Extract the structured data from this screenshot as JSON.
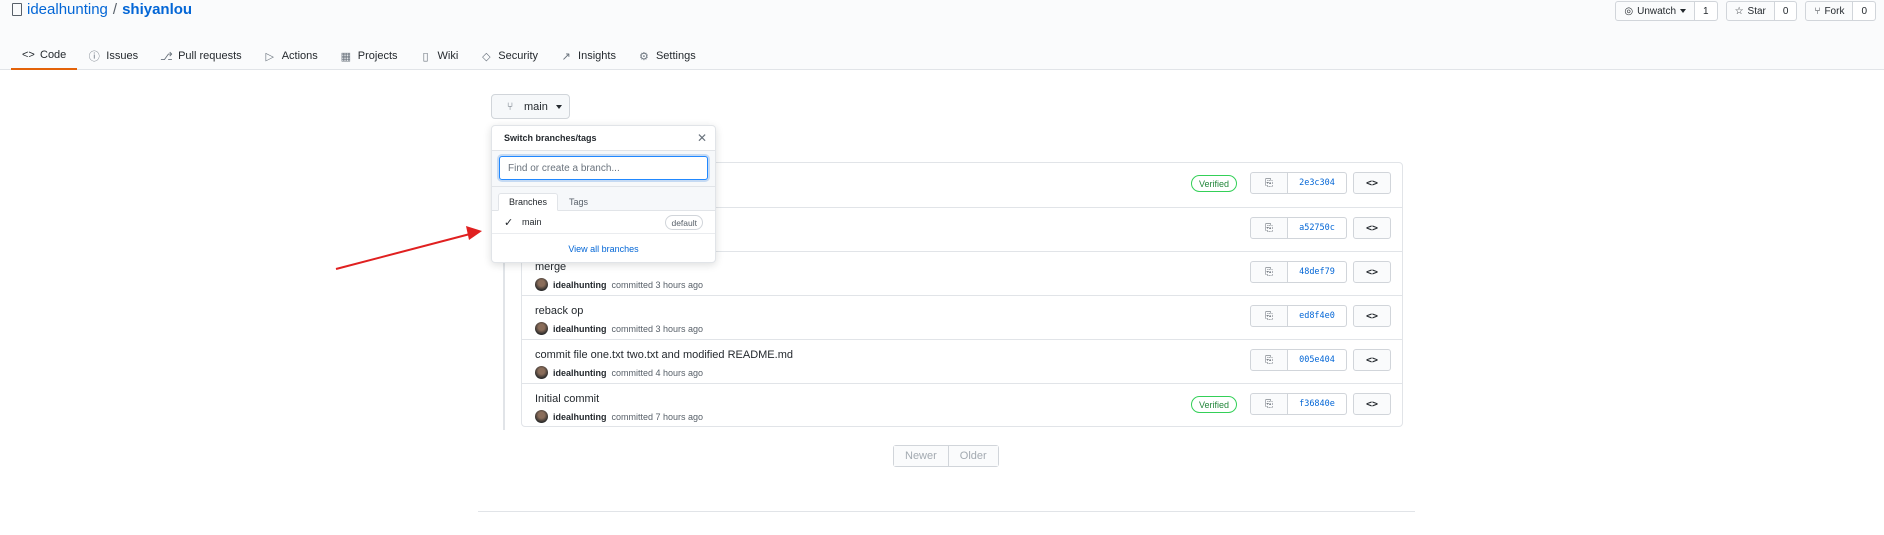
{
  "repo": {
    "owner": "idealhunting",
    "separator": "/",
    "name": "shiyanlou"
  },
  "actions": [
    {
      "label": "Unwatch",
      "count": "1",
      "icon": "eye-icon"
    },
    {
      "label": "Star",
      "count": "0",
      "icon": "star-icon"
    },
    {
      "label": "Fork",
      "count": "0",
      "icon": "fork-icon"
    }
  ],
  "tabs": [
    {
      "label": "Code",
      "icon": "code-icon",
      "active": true
    },
    {
      "label": "Issues",
      "icon": "issue-icon"
    },
    {
      "label": "Pull requests",
      "icon": "pull-request-icon"
    },
    {
      "label": "Actions",
      "icon": "play-icon"
    },
    {
      "label": "Projects",
      "icon": "project-icon"
    },
    {
      "label": "Wiki",
      "icon": "book-icon"
    },
    {
      "label": "Security",
      "icon": "shield-icon"
    },
    {
      "label": "Insights",
      "icon": "graph-icon"
    },
    {
      "label": "Settings",
      "icon": "gear-icon"
    }
  ],
  "branch": {
    "label": "main",
    "icon": "branch-icon"
  },
  "dropdown": {
    "title": "Switch branches/tags",
    "filter_placeholder": "Find or create a branch...",
    "tabs": [
      "Branches",
      "Tags"
    ],
    "selected_tab": "Branches",
    "items": [
      {
        "name": "main",
        "badge": "default",
        "checked": true
      }
    ],
    "footer": "View all branches"
  },
  "commits": [
    {
      "message": "",
      "author": "",
      "time": "",
      "verified": true,
      "sha": "2e3c304"
    },
    {
      "message": "",
      "author": "",
      "time": "",
      "verified": false,
      "sha": "a52750c"
    },
    {
      "message": "merge",
      "author": "idealhunting",
      "time": "committed 3 hours ago",
      "verified": false,
      "sha": "48def79"
    },
    {
      "message": "reback op",
      "author": "idealhunting",
      "time": "committed 3 hours ago",
      "verified": false,
      "sha": "ed8f4e0"
    },
    {
      "message": "commit file one.txt two.txt and modified README.md",
      "author": "idealhunting",
      "time": "committed 4 hours ago",
      "verified": false,
      "sha": "005e404"
    },
    {
      "message": "Initial commit",
      "author": "idealhunting",
      "time": "committed 7 hours ago",
      "verified": true,
      "sha": "f36840e"
    }
  ],
  "verified_label": "Verified",
  "pagination": {
    "newer": "Newer",
    "older": "Older"
  },
  "colors": {
    "link": "#0366d6",
    "verified": "#22863a",
    "active_tab": "#e36209",
    "annotation_arrow": "#e02020"
  }
}
